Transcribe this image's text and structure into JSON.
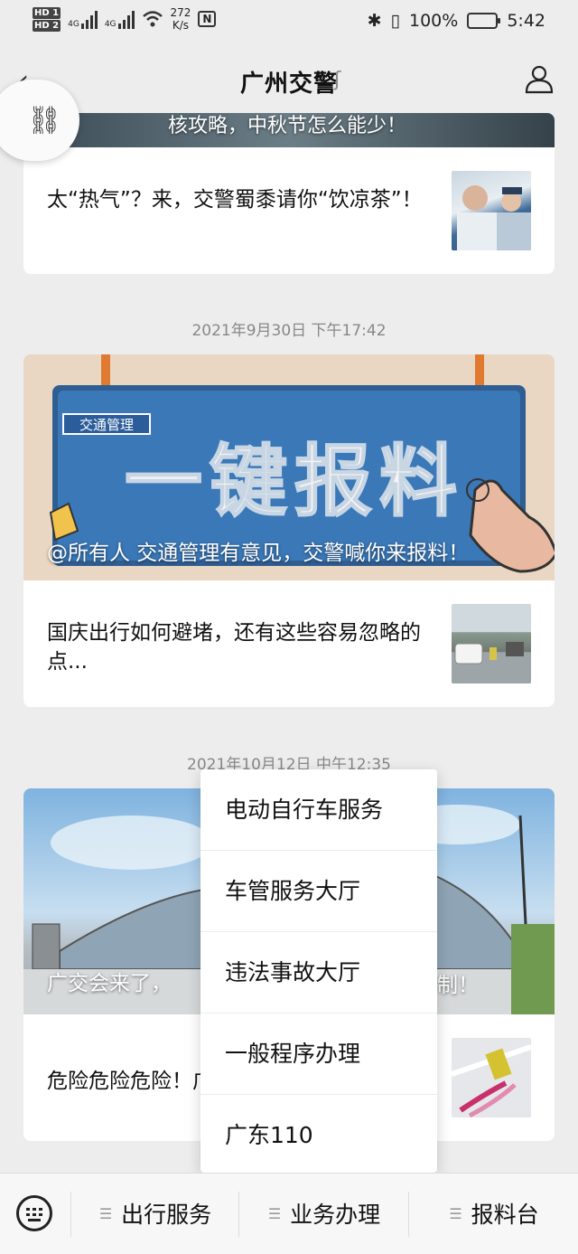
{
  "status_bar": {
    "hd1": "HD 1",
    "hd2": "HD 2",
    "net1": "4G",
    "net2": "4G",
    "speed_value": "272",
    "speed_unit": "K/s",
    "nfc": "N",
    "battery": "100%",
    "time": "5:42"
  },
  "header": {
    "title": "广州交警"
  },
  "feed": {
    "group1": {
      "cover_title": "核攻略，中秋节怎么能少！",
      "item_text": "太“热气”？来，交警蜀黍请你“饮凉茶”！"
    },
    "group2": {
      "date": "2021年9月30日 下午17:42",
      "sign_tag": "交通管理",
      "sign_text": "一键报料",
      "cover_title": "@所有人 交通管理有意见，交警喊你来报料！",
      "item_text": "国庆出行如何避堵，还有这些容易忽略的点..."
    },
    "group3": {
      "date": "2021年10月12日 中午12:35",
      "cover_title_left": "广交会来了，",
      "cover_title_right": "制！",
      "item_text": "危险危险危险！广"
    }
  },
  "popup_menu": {
    "items": [
      "电动自行车服务",
      "车管服务大厅",
      "违法事故大厅",
      "一般程序办理",
      "广东110"
    ]
  },
  "bottom_menu": {
    "tabs": [
      "出行服务",
      "业务办理",
      "报料台"
    ]
  },
  "colors": {
    "background": "#ededed",
    "sign_blue": "#3a78b8"
  }
}
